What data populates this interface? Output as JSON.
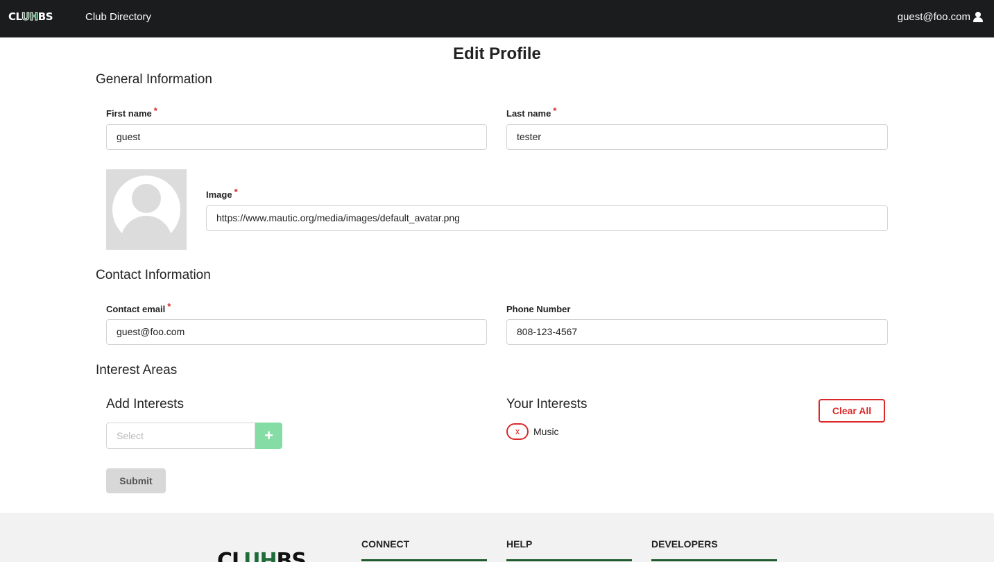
{
  "navbar": {
    "logo_left": "CL",
    "logo_mid": "UH",
    "logo_right": "BS",
    "directory_link": "Club Directory",
    "user_email": "guest@foo.com",
    "user_icon": "user-icon"
  },
  "page": {
    "title": "Edit Profile"
  },
  "general": {
    "title": "General Information",
    "first_name_label": "First name",
    "first_name_value": "guest",
    "last_name_label": "Last name",
    "last_name_value": "tester",
    "image_label": "Image",
    "image_value": "https://www.mautic.org/media/images/default_avatar.png",
    "required_mark": "*"
  },
  "contact": {
    "title": "Contact Information",
    "email_label": "Contact email",
    "email_value": "guest@foo.com",
    "phone_label": "Phone Number",
    "phone_value": "808-123-4567"
  },
  "interests": {
    "title": "Interest Areas",
    "add_title": "Add Interests",
    "select_placeholder": "Select",
    "add_button_icon": "plus-icon",
    "add_button_symbol": "+",
    "your_title": "Your Interests",
    "clear_all_label": "Clear All",
    "remove_label": "x",
    "items": [
      "Music"
    ]
  },
  "form": {
    "submit_label": "Submit"
  },
  "footer": {
    "logo_left": "CL",
    "logo_mid": "UH",
    "logo_right": "BS",
    "columns": [
      "CONNECT",
      "HELP",
      "DEVELOPERS"
    ]
  },
  "colors": {
    "navbar_bg": "#1b1c1d",
    "brand_green": "#1f6b3a",
    "danger": "#db2828",
    "add_button": "#86dca5"
  }
}
